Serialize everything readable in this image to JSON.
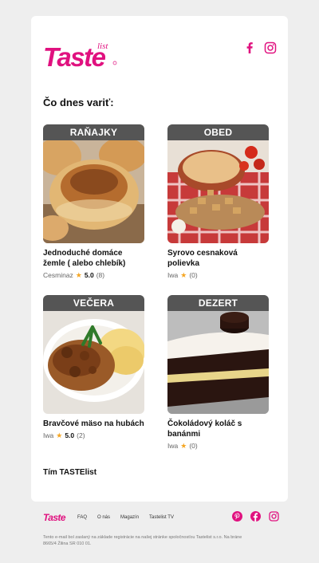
{
  "brand": {
    "name": "Taste",
    "suffix": "list",
    "color": "#e0117f"
  },
  "header": {
    "social": [
      "facebook-icon",
      "instagram-icon"
    ]
  },
  "main": {
    "heading": "Čo dnes variť:",
    "recipes": [
      {
        "category": "RAŇAJKY",
        "title": "Jednoduché domáce žemle ( alebo chlebík)",
        "author": "Cesminaz",
        "rating": "5.0",
        "count": "(8)"
      },
      {
        "category": "OBED",
        "title": "Syrovo cesnaková polievka",
        "author": "Iwa",
        "rating": "",
        "count": "(0)"
      },
      {
        "category": "VEČERA",
        "title": "Bravčové mäso na hubách",
        "author": "Iwa",
        "rating": "5.0",
        "count": "(2)"
      },
      {
        "category": "DEZERT",
        "title": "Čokoládový koláč s banánmi",
        "author": "Iwa",
        "rating": "",
        "count": "(0)"
      }
    ],
    "signature": "Tím TASTElist"
  },
  "footer": {
    "links": [
      "FAQ",
      "O nás",
      "Magazín",
      "Tastelist TV"
    ],
    "social": [
      "pinterest-icon",
      "facebook-icon",
      "instagram-icon"
    ],
    "legal": "Tento e-mail bol zaslaný na základe registrácie na našej stránke spoločnosťou Tastelist s.r.o. Na bráne 8665/4 Žilina SR 010 01."
  },
  "colors": {
    "accent": "#e0117f",
    "badge_bg": "#555555",
    "star": "#f5a623",
    "page_bg": "#eeeeee"
  }
}
